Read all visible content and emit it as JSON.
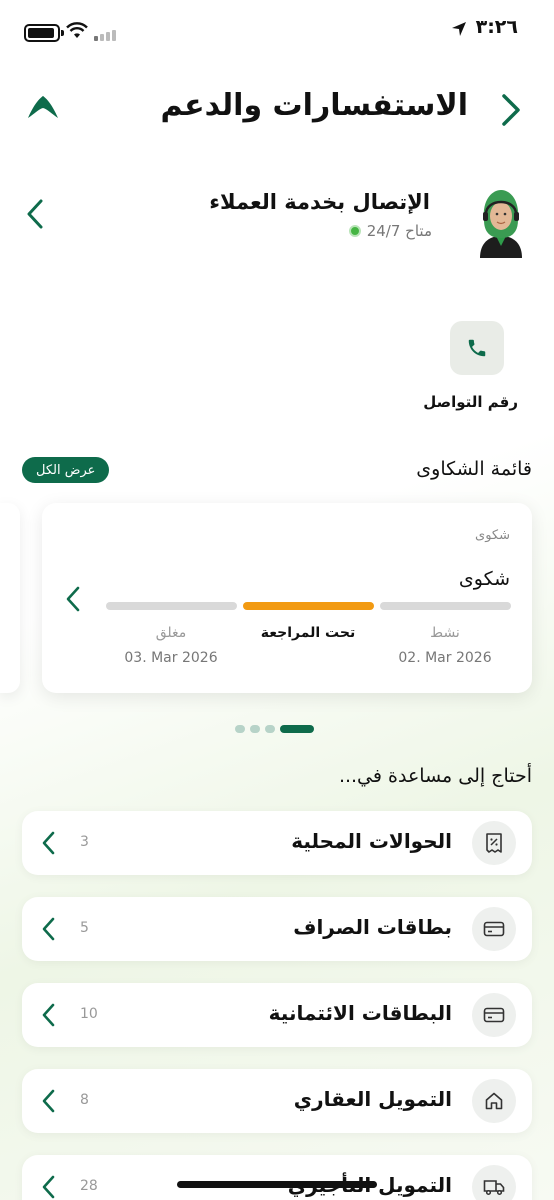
{
  "status_bar": {
    "time": "٣:٢٦"
  },
  "header": {
    "title": "الاستفسارات والدعم"
  },
  "agent": {
    "name": "الإتصال بخدمة العملاء",
    "availability": "متاح 24/7"
  },
  "contact": {
    "phone_label": "رقم التواصل"
  },
  "complaints": {
    "title": "قائمة الشكاوى",
    "view_all": "عرض الكل",
    "card": {
      "category": "شكوى",
      "title": "شكوى",
      "steps": [
        {
          "label": "نشط",
          "date": "02. Mar 2026",
          "state": "done"
        },
        {
          "label": "تحت المراجعة",
          "date": "",
          "state": "current"
        },
        {
          "label": "مغلق",
          "date": "03. Mar 2026",
          "state": "pending"
        }
      ]
    },
    "pagination": {
      "pages": 4,
      "active": 1
    }
  },
  "help": {
    "title": "أحتاج إلى مساعدة في...",
    "items": [
      {
        "label": "الحوالات المحلية",
        "count": "3",
        "icon": "receipt-icon"
      },
      {
        "label": "بطاقات الصراف",
        "count": "5",
        "icon": "card-icon"
      },
      {
        "label": "البطاقات الائتمانية",
        "count": "10",
        "icon": "card-icon"
      },
      {
        "label": "التمويل العقاري",
        "count": "8",
        "icon": "home-icon"
      },
      {
        "label": "التمويل التأجيري",
        "count": "28",
        "icon": "truck-icon"
      }
    ]
  },
  "colors": {
    "brand": "#0e6b4b",
    "progress_active": "#f29a12",
    "progress_inactive": "#d9d9d9",
    "online": "#45b543"
  }
}
